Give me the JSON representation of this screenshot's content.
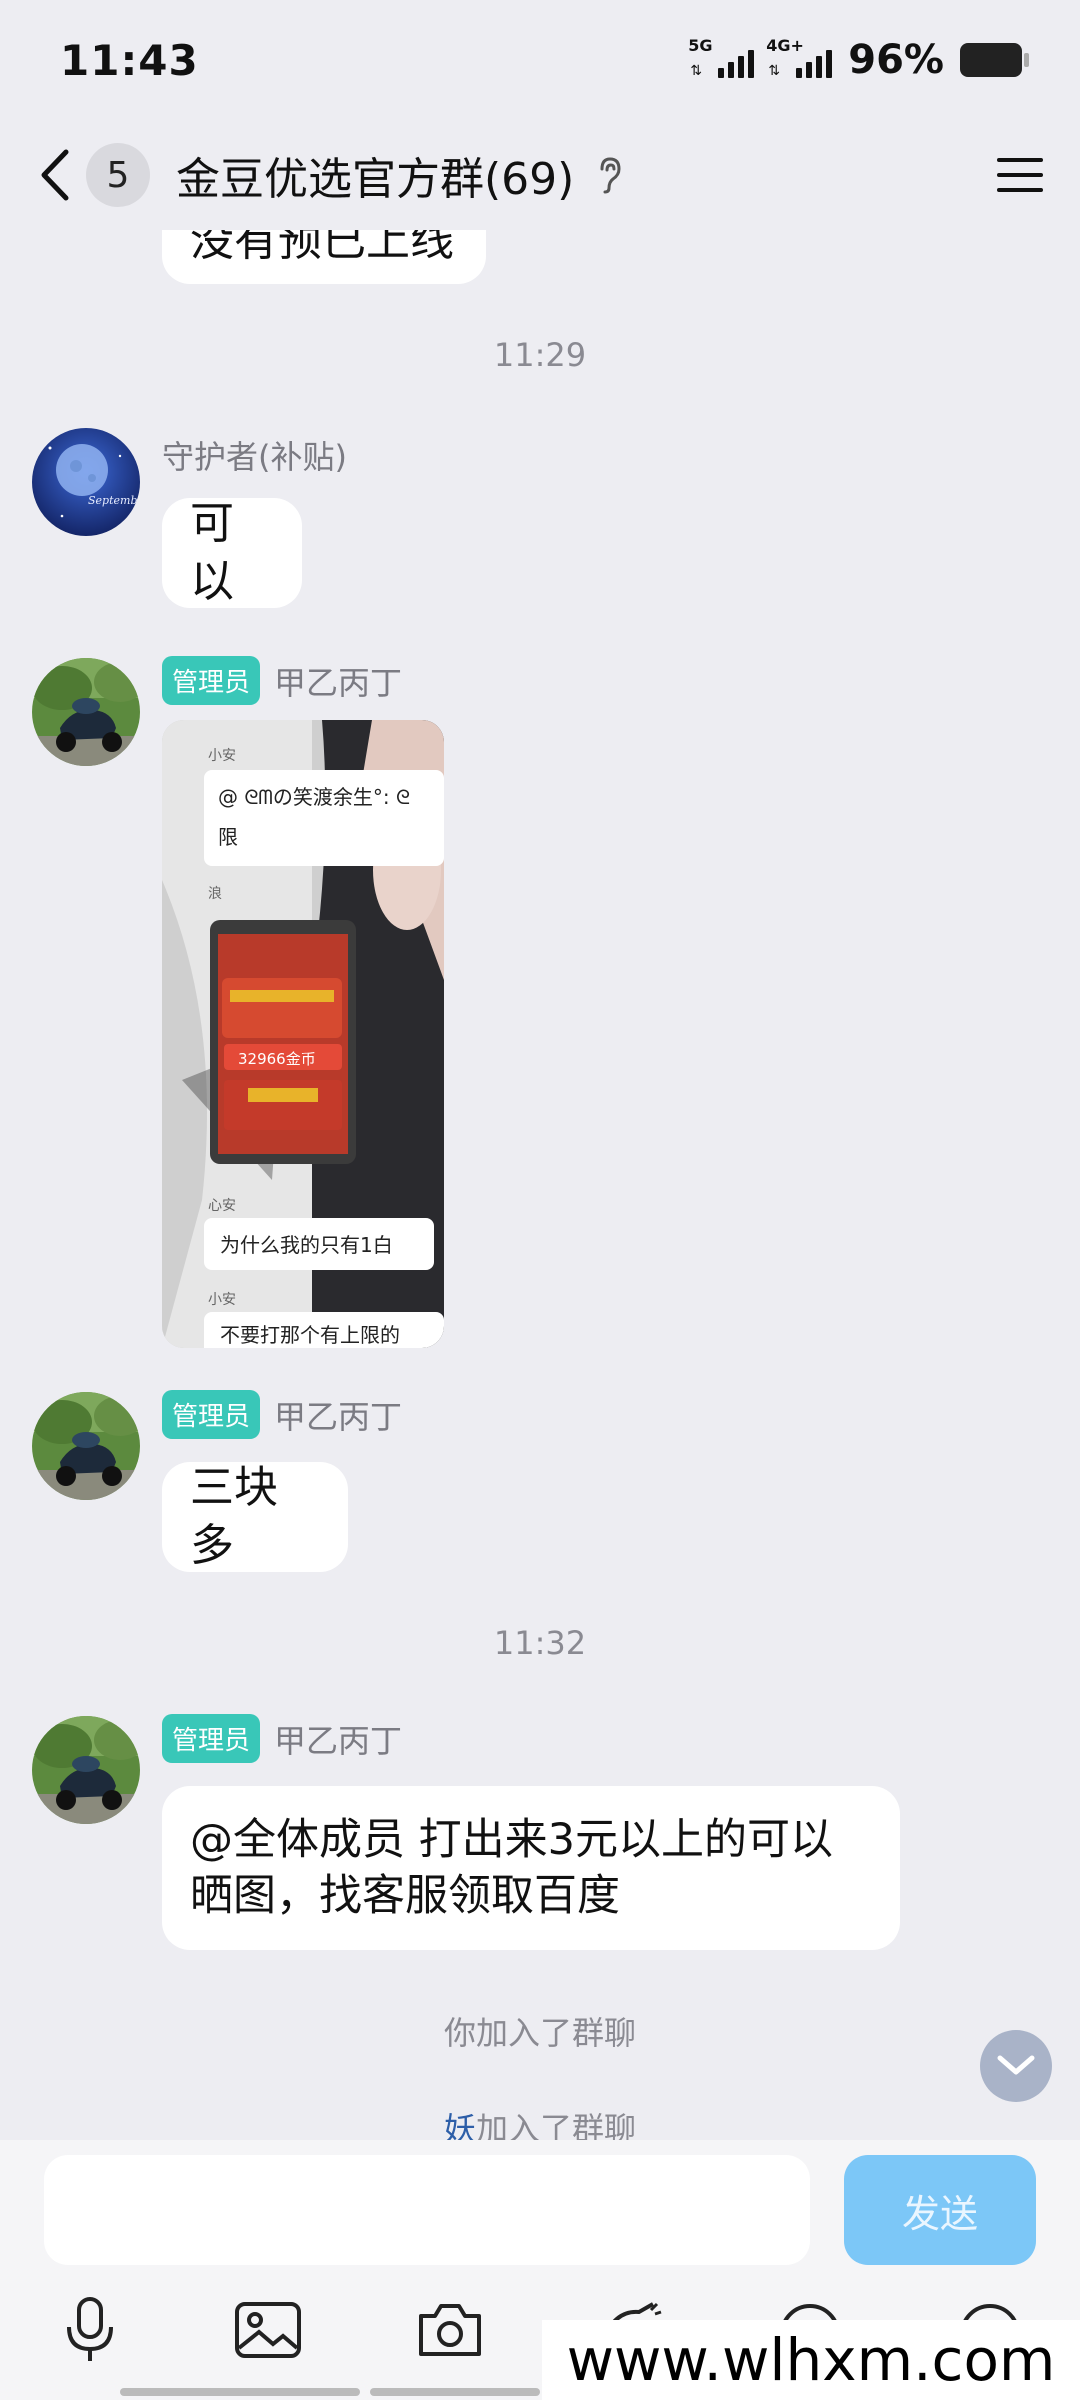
{
  "status": {
    "time": "11:43",
    "sim1_tag": "5G",
    "sim2_tag": "4G+",
    "battery": "96%"
  },
  "header": {
    "unread_count": "5",
    "title": "金豆优选官方群(69)"
  },
  "messages": {
    "prev_fragment": "没有预已上线",
    "time1": "11:29",
    "m1_sender": "守护者(补贴)",
    "m1_text": "可以",
    "admin_badge": "管理员",
    "m2_sender": "甲乙丙丁",
    "m3_sender": "甲乙丙丁",
    "m3_text": "三块多",
    "time2": "11:32",
    "m4_sender": "甲乙丙丁",
    "m4_line1": "@全体成员 打出来3元以上的可以",
    "m4_line2": "晒图，找客服领取百度",
    "sys1": "你加入了群聊",
    "sys2_name": "妖",
    "sys2_text": "加入了群聊"
  },
  "screenshot_image": {
    "name1": "小安",
    "bubble1_line1": "@ ᘓᗰの笑渡余生°: ᘓ",
    "bubble1_line2": "限",
    "name2": "浪",
    "coins": "32966金币",
    "name3": "心安",
    "bubble2": "为什么我的只有1白",
    "name4": "小安",
    "bubble3": "不要打那个有上限的"
  },
  "input": {
    "placeholder": "",
    "send_label": "发送"
  },
  "watermark": "www.wlhxm.com",
  "colors": {
    "background": "#ededf2",
    "admin_badge": "#39c7b8",
    "send_button": "#7cc7f7"
  }
}
